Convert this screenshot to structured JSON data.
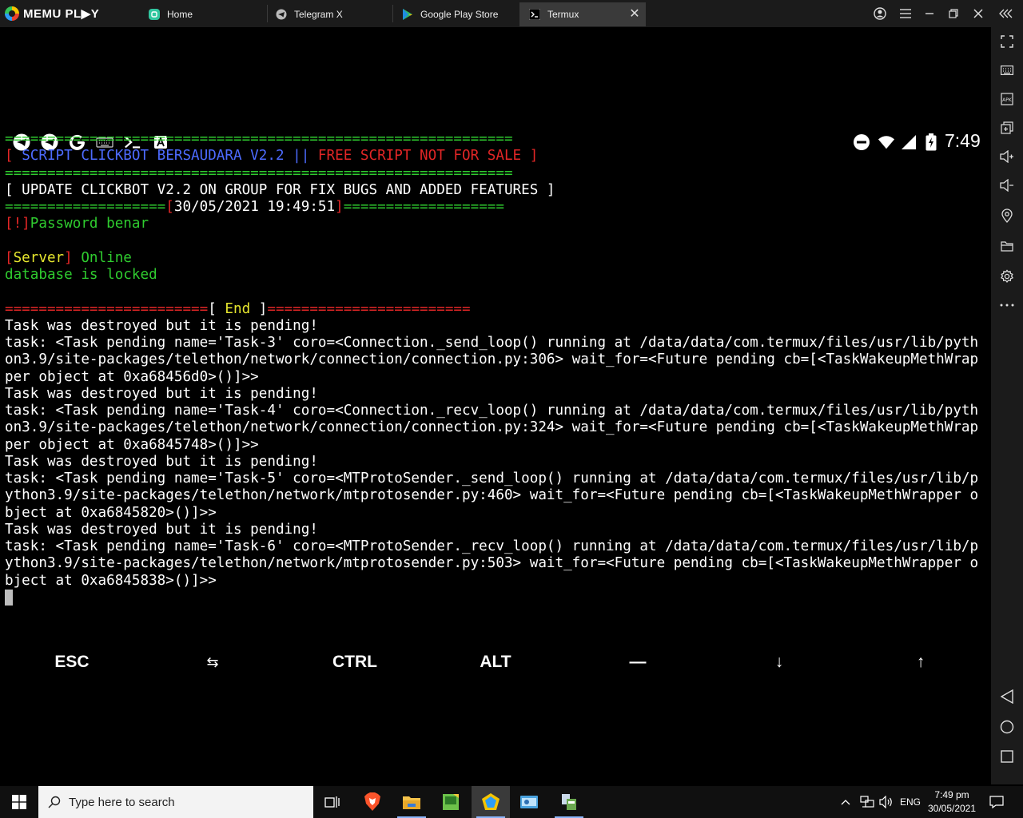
{
  "titlebar": {
    "logo_text": "MEMU PL▶Y",
    "tabs": [
      {
        "label": "Home",
        "icon": "home-app-icon"
      },
      {
        "label": "Telegram X",
        "icon": "telegram-icon"
      },
      {
        "label": "Google Play Store",
        "icon": "play-store-icon"
      },
      {
        "label": "Termux",
        "icon": "terminal-icon",
        "active": true
      }
    ],
    "close_glyph": "✕"
  },
  "statusbar": {
    "time": "7:49"
  },
  "terminal": {
    "lines": [
      [
        {
          "t": "============================================================",
          "c": "g"
        }
      ],
      [
        {
          "t": "[ ",
          "c": "r"
        },
        {
          "t": "SCRIPT CLICKBOT BERSAUDARA V2.2 || ",
          "c": "b"
        },
        {
          "t": "FREE SCRIPT NOT FOR SALE ]",
          "c": "r"
        }
      ],
      [
        {
          "t": "============================================================",
          "c": "g"
        }
      ],
      [
        {
          "t": "[ UPDATE CLICKBOT V2.2 ON GROUP FOR FIX BUGS AND ADDED FEATURES ]",
          "c": "w"
        }
      ],
      [
        {
          "t": "===================",
          "c": "g"
        },
        {
          "t": "[",
          "c": "r"
        },
        {
          "t": "30/05/2021 19:49:51",
          "c": "w"
        },
        {
          "t": "]",
          "c": "r"
        },
        {
          "t": "===================",
          "c": "g"
        }
      ],
      [
        {
          "t": "[!]",
          "c": "r"
        },
        {
          "t": "Password benar",
          "c": "g"
        }
      ],
      [
        {
          "t": " ",
          "c": "w"
        }
      ],
      [
        {
          "t": "[",
          "c": "r"
        },
        {
          "t": "Server",
          "c": "y"
        },
        {
          "t": "] ",
          "c": "r"
        },
        {
          "t": "Online",
          "c": "g"
        }
      ],
      [
        {
          "t": "database is locked",
          "c": "g"
        }
      ],
      [
        {
          "t": " ",
          "c": "w"
        }
      ],
      [
        {
          "t": "========================",
          "c": "r"
        },
        {
          "t": "[ ",
          "c": "w"
        },
        {
          "t": "End",
          "c": "y"
        },
        {
          "t": " ]",
          "c": "w"
        },
        {
          "t": "========================",
          "c": "r"
        }
      ],
      [
        {
          "t": "Task was destroyed but it is pending!",
          "c": "w"
        }
      ],
      [
        {
          "t": "task: <Task pending name='Task-3' coro=<Connection._send_loop() running at /data/data/com.termux/files/usr/lib/pyth",
          "c": "w"
        }
      ],
      [
        {
          "t": "on3.9/site-packages/telethon/network/connection/connection.py:306> wait_for=<Future pending cb=[<TaskWakeupMethWrap",
          "c": "w"
        }
      ],
      [
        {
          "t": "per object at 0xa68456d0>()]>>",
          "c": "w"
        }
      ],
      [
        {
          "t": "Task was destroyed but it is pending!",
          "c": "w"
        }
      ],
      [
        {
          "t": "task: <Task pending name='Task-4' coro=<Connection._recv_loop() running at /data/data/com.termux/files/usr/lib/pyth",
          "c": "w"
        }
      ],
      [
        {
          "t": "on3.9/site-packages/telethon/network/connection/connection.py:324> wait_for=<Future pending cb=[<TaskWakeupMethWrap",
          "c": "w"
        }
      ],
      [
        {
          "t": "per object at 0xa6845748>()]>>",
          "c": "w"
        }
      ],
      [
        {
          "t": "Task was destroyed but it is pending!",
          "c": "w"
        }
      ],
      [
        {
          "t": "task: <Task pending name='Task-5' coro=<MTProtoSender._send_loop() running at /data/data/com.termux/files/usr/lib/p",
          "c": "w"
        }
      ],
      [
        {
          "t": "ython3.9/site-packages/telethon/network/mtprotosender.py:460> wait_for=<Future pending cb=[<TaskWakeupMethWrapper o",
          "c": "w"
        }
      ],
      [
        {
          "t": "bject at 0xa6845820>()]>>",
          "c": "w"
        }
      ],
      [
        {
          "t": "Task was destroyed but it is pending!",
          "c": "w"
        }
      ],
      [
        {
          "t": "task: <Task pending name='Task-6' coro=<MTProtoSender._recv_loop() running at /data/data/com.termux/files/usr/lib/p",
          "c": "w"
        }
      ],
      [
        {
          "t": "ython3.9/site-packages/telethon/network/mtprotosender.py:503> wait_for=<Future pending cb=[<TaskWakeupMethWrapper o",
          "c": "w"
        }
      ],
      [
        {
          "t": "bject at 0xa6845838>()]>>",
          "c": "w"
        }
      ]
    ]
  },
  "extra_keys": [
    "ESC",
    "⇆",
    "CTRL",
    "ALT",
    "—",
    "↓",
    "↑"
  ],
  "taskbar": {
    "search_placeholder": "Type here to search",
    "language": "ENG",
    "time": "7:49 pm",
    "date": "30/05/2021"
  },
  "colors": {
    "terminal_green": "#2fcc2f",
    "terminal_red": "#e22626",
    "terminal_blue": "#4d6bff",
    "terminal_yellow": "#e6e62e"
  }
}
